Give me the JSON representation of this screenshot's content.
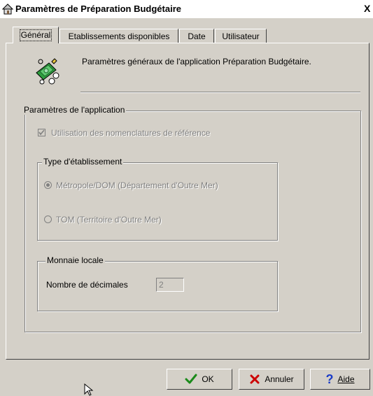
{
  "window": {
    "title": "Paramètres de Préparation Budgétaire",
    "close_glyph": "X"
  },
  "tabs": [
    {
      "label": "Général",
      "active": true
    },
    {
      "label": "Etablissements disponibles",
      "active": false
    },
    {
      "label": "Date",
      "active": false
    },
    {
      "label": "Utilisateur",
      "active": false
    }
  ],
  "header": {
    "description": "Paramètres généraux de l'application Préparation Budgétaire.",
    "icon": "money-icon"
  },
  "app_params": {
    "label": "Paramètres de l'application",
    "nomenclature_checkbox": {
      "label": "Utilisation des nomenclatures de référence",
      "checked": true,
      "enabled": false
    }
  },
  "type_etablissement": {
    "label": "Type d'établissement",
    "options": [
      {
        "label": "Métropole/DOM (Département d'Outre Mer)",
        "selected": true,
        "enabled": false
      },
      {
        "label": "TOM (Territoire d'Outre Mer)",
        "selected": false,
        "enabled": false
      }
    ]
  },
  "monnaie": {
    "label": "Monnaie locale",
    "decimals_label": "Nombre de décimales",
    "decimals_value": "2"
  },
  "buttons": {
    "ok": {
      "label": "OK",
      "icon": "check-icon"
    },
    "cancel": {
      "label": "Annuler",
      "icon": "cross-icon"
    },
    "help": {
      "label": "Aide",
      "icon": "question-icon"
    }
  },
  "colors": {
    "face": "#d4d0c8",
    "check_green": "#1a8a1a",
    "cancel_red": "#cc0000",
    "help_blue": "#1a3cc8"
  }
}
